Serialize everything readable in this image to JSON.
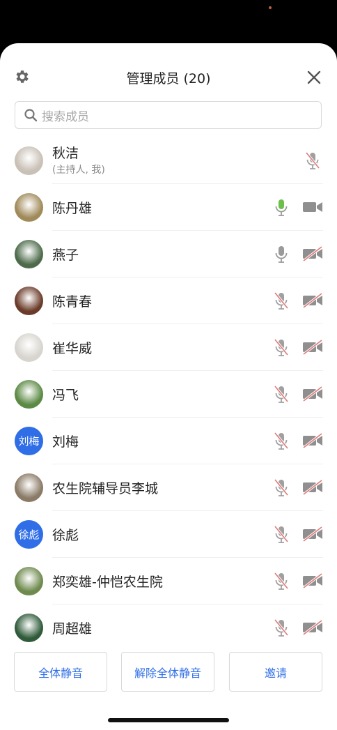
{
  "header": {
    "title": "管理成员 (20)"
  },
  "search": {
    "placeholder": "搜索成员"
  },
  "members": [
    {
      "name": "秋洁",
      "subtitle": "(主持人, 我)",
      "avatar": "photo",
      "avatar_color": "#c9c0b6",
      "mic": "muted",
      "camera": "none"
    },
    {
      "name": "陈丹雄",
      "avatar": "photo",
      "avatar_color": "#a08a5a",
      "mic": "speaking",
      "camera": "on"
    },
    {
      "name": "燕子",
      "avatar": "photo",
      "avatar_color": "#4d6b4a",
      "mic": "on",
      "camera": "off"
    },
    {
      "name": "陈青春",
      "avatar": "photo",
      "avatar_color": "#6b3b2a",
      "mic": "muted",
      "camera": "off"
    },
    {
      "name": "崔华威",
      "avatar": "photo",
      "avatar_color": "#d8d5cf",
      "mic": "muted",
      "camera": "off"
    },
    {
      "name": "冯飞",
      "avatar": "photo",
      "avatar_color": "#5c8a45",
      "mic": "muted",
      "camera": "off"
    },
    {
      "name": "刘梅",
      "avatar": "text",
      "avatar_text": "刘梅",
      "avatar_color": "#2f6ee6",
      "mic": "muted",
      "camera": "off"
    },
    {
      "name": "农生院辅导员李城",
      "avatar": "photo",
      "avatar_color": "#8a7a66",
      "mic": "muted",
      "camera": "off"
    },
    {
      "name": "徐彪",
      "avatar": "text",
      "avatar_text": "徐彪",
      "avatar_color": "#2f6ee6",
      "mic": "muted",
      "camera": "off"
    },
    {
      "name": "郑奕雄-仲恺农生院",
      "avatar": "photo",
      "avatar_color": "#6f8a4e",
      "mic": "muted",
      "camera": "off"
    },
    {
      "name": "周超雄",
      "avatar": "photo",
      "avatar_color": "#2f5b3a",
      "mic": "muted",
      "camera": "off"
    }
  ],
  "actions": {
    "mute_all": "全体静音",
    "unmute_all": "解除全体静音",
    "invite": "邀请"
  },
  "colors": {
    "accent": "#2f6ee6",
    "muted_slash": "#e07a7a",
    "speaking": "#6cc04a",
    "icon_gray": "#9a9a9a"
  }
}
